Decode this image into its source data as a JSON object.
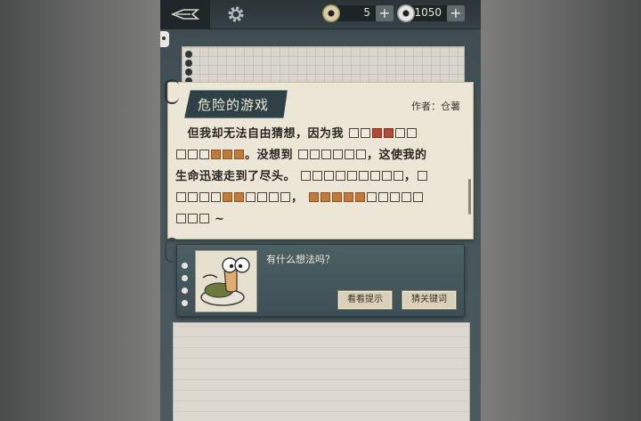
{
  "topbar": {
    "logo_icon": "quill-pen-icon",
    "settings_icon": "gear-icon",
    "currency1": {
      "icon": "hint-token-icon",
      "value": "5",
      "plus": "+"
    },
    "currency2": {
      "icon": "coin-icon",
      "value": "1050",
      "plus": "+"
    }
  },
  "story": {
    "title": "危险的游戏",
    "author": "作者：仓薯",
    "lines": [
      [
        "　但我却无法自由猜想，因为我"
      ],
      [
        "。没想到",
        "，这使我的"
      ],
      [
        "生命迅速走到了尽头。",
        "，"
      ],
      [
        "，"
      ],
      [
        "~"
      ]
    ]
  },
  "hint_panel": {
    "question": "有什么想法吗？",
    "show_hint_label": "看看提示",
    "guess_keyword_label": "猜关键词"
  },
  "colors": {
    "revealed_orange": "#c27a3c",
    "revealed_red": "#b24a3c",
    "panel": "#445659"
  }
}
